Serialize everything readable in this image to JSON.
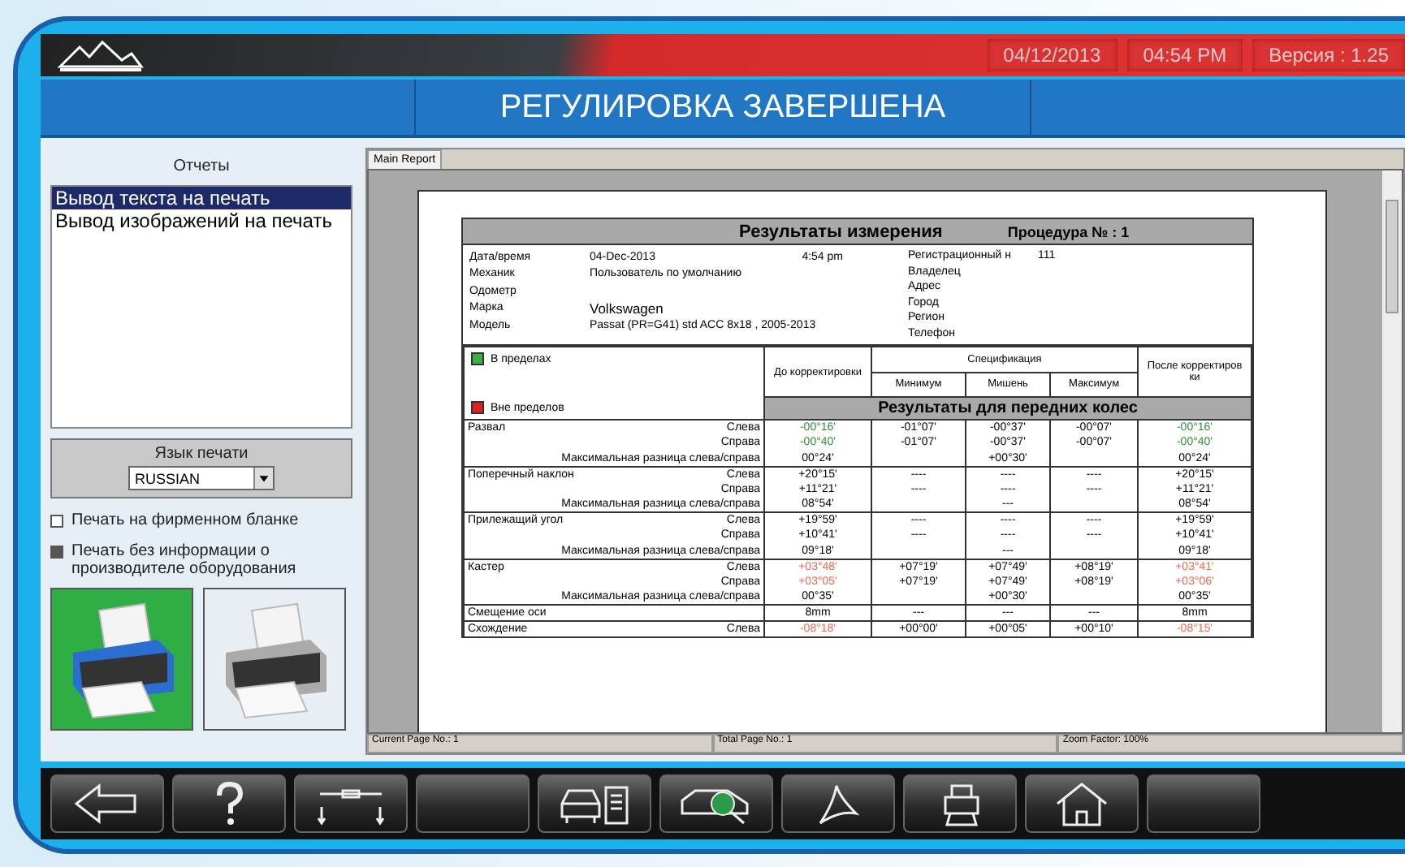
{
  "header": {
    "date": "04/12/2013",
    "time": "04:54 PM",
    "version": "Версия : 1.25"
  },
  "title": "РЕГУЛИРОВКА ЗАВЕРШЕНА",
  "reports": {
    "title": "Отчеты",
    "items": [
      {
        "label": "Вывод текста на печать",
        "selected": true
      },
      {
        "label": "Вывод изображений на печать",
        "selected": false
      }
    ]
  },
  "print_language": {
    "label": "Язык печати",
    "value": "RUSSIAN"
  },
  "options": [
    {
      "label": "Печать на фирменном бланке",
      "checked": false
    },
    {
      "label": "Печать без информации о производителе оборудования",
      "checked": true
    }
  ],
  "printers": [
    {
      "selected": true
    },
    {
      "selected": false
    }
  ],
  "viewer": {
    "tab": "Main Report",
    "report": {
      "title": "Результаты измерения",
      "procedure": "Процедура № :  1",
      "info_left": [
        {
          "label": "Дата/время",
          "value": "04-Dec-2013",
          "extra": "4:54 pm"
        },
        {
          "label": "Механик",
          "value": "Пользователь по умолчанию"
        },
        {
          "label": "Одометр"
        },
        {
          "label": "Марка",
          "value": "Volkswagen",
          "large": true
        },
        {
          "label": "Модель",
          "value": "Passat (PR=G41) std ACC 8x18 , 2005-2013"
        }
      ],
      "info_right": [
        {
          "label": "Регистрационный н",
          "value": "111"
        },
        {
          "label": "Владелец"
        },
        {
          "label": "Адрес"
        },
        {
          "label": "Город"
        },
        {
          "label": "Регион"
        },
        {
          "label": "Телефон"
        }
      ],
      "legend": [
        {
          "label": "В пределах",
          "color": "#3cb043"
        },
        {
          "label": "Вне пределов",
          "color": "#e02020"
        }
      ],
      "col_before": "До корректировки",
      "col_spec": "Спецификация",
      "col_min": "Минимум",
      "col_target": "Мишень",
      "col_max": "Максимум",
      "col_after": "После корректиров ки",
      "section": "Результаты для передних колес",
      "groups": [
        {
          "name": "Развал",
          "rows": [
            {
              "side": "Слева",
              "before": "-00°16'",
              "min": "-01°07'",
              "target": "-00°37'",
              "max": "-00°07'",
              "after": "-00°16'",
              "color": "#2f8f3a"
            },
            {
              "side": "Справа",
              "before": "-00°40'",
              "min": "-01°07'",
              "target": "-00°37'",
              "max": "-00°07'",
              "after": "-00°40'",
              "color": "#2f8f3a"
            },
            {
              "side": "Максимальная разница слева/справа",
              "before": "00°24'",
              "target": "+00°30'",
              "after": "00°24'"
            }
          ]
        },
        {
          "name": "Поперечный наклон",
          "rows": [
            {
              "side": "Слева",
              "before": "+20°15'",
              "min": "----",
              "target": "----",
              "max": "----",
              "after": "+20°15'"
            },
            {
              "side": "Справа",
              "before": "+11°21'",
              "min": "----",
              "target": "----",
              "max": "----",
              "after": "+11°21'"
            },
            {
              "side": "Максимальная разница слева/справа",
              "before": "08°54'",
              "target": "---",
              "after": "08°54'"
            }
          ]
        },
        {
          "name": "Прилежащий угол",
          "rows": [
            {
              "side": "Слева",
              "before": "+19°59'",
              "min": "----",
              "target": "----",
              "max": "----",
              "after": "+19°59'"
            },
            {
              "side": "Справа",
              "before": "+10°41'",
              "min": "----",
              "target": "----",
              "max": "----",
              "after": "+10°41'"
            },
            {
              "side": "Максимальная разница слева/справа",
              "before": "09°18'",
              "target": "---",
              "after": "09°18'"
            }
          ]
        },
        {
          "name": "Кастер",
          "rows": [
            {
              "side": "Слева",
              "before": "+03°48'",
              "min": "+07°19'",
              "target": "+07°49'",
              "max": "+08°19'",
              "after": "+03°41'",
              "color": "#f06a50"
            },
            {
              "side": "Справа",
              "before": "+03°05'",
              "min": "+07°19'",
              "target": "+07°49'",
              "max": "+08°19'",
              "after": "+03°06'",
              "color": "#f06a50"
            },
            {
              "side": "Максимальная разница слева/справа",
              "before": "00°35'",
              "target": "+00°30'",
              "after": "00°35'"
            }
          ]
        },
        {
          "name": "Смещение оси",
          "rows": [
            {
              "before": "8mm",
              "min": "---",
              "target": "---",
              "max": "---",
              "after": "8mm"
            }
          ]
        },
        {
          "name": "Схождение",
          "rows": [
            {
              "side": "Слева",
              "before": "-08°18'",
              "min": "+00°00'",
              "target": "+00°05'",
              "max": "+00°10'",
              "after": "-08°15'",
              "color": "#f06a50"
            }
          ]
        }
      ]
    },
    "status": [
      "Current Page No.: 1",
      "Total Page No.: 1",
      "Zoom Factor: 100%"
    ]
  },
  "toolbar": [
    {
      "kind": "back"
    },
    {
      "kind": "help"
    },
    {
      "kind": "lift"
    },
    {
      "kind": "blank"
    },
    {
      "kind": "car-report"
    },
    {
      "kind": "car-search"
    },
    {
      "kind": "pdf"
    },
    {
      "kind": "print"
    },
    {
      "kind": "home"
    },
    {
      "kind": "blank"
    }
  ]
}
